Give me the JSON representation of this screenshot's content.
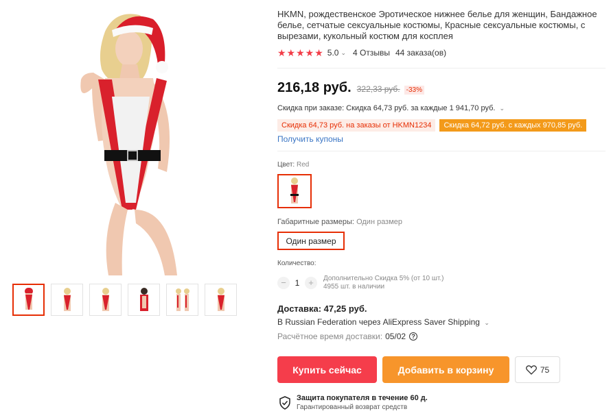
{
  "product": {
    "title": "HKMN, рождественское Эротическое нижнее белье для женщин, Бандажное белье, сетчатые сексуальные костюмы, Красные сексуальные костюмы, с вырезами, кукольный костюм для косплея",
    "rating": {
      "stars": "★★★★★",
      "value": "5.0",
      "reviews": "4 Отзывы",
      "orders": "44 заказа(ов)"
    },
    "price": {
      "current": "216,18 руб.",
      "old": "322,33 руб.",
      "discount": "-33%"
    },
    "coupon_line": "Скидка при заказе: Скидка 64,73 руб. за каждые 1 941,70 руб.",
    "badges": [
      "Скидка 64,73 руб. на заказы от HKMN1234",
      "Скидка 64,72 руб. с каждых 970,85 руб."
    ],
    "get_coupons": "Получить купоны",
    "color": {
      "label": "Цвет: ",
      "value": "Red"
    },
    "size": {
      "label": "Габаритные размеры: ",
      "value": "Один размер",
      "option": "Один размер"
    },
    "quantity": {
      "label": "Количество:",
      "value": "1",
      "minus": "−",
      "plus": "+",
      "extra_discount": "Дополнительно Скидка 5% (от 10 шт.)",
      "stock": "4955 шт. в наличии"
    },
    "delivery": {
      "cost": "Доставка: 47,25 руб.",
      "via": "В Russian Federation через AliExpress Saver Shipping",
      "est_label": "Расчётное время доставки:",
      "est_date": "05/02",
      "help": "?"
    },
    "buttons": {
      "buy": "Купить сейчас",
      "cart": "Добавить в корзину",
      "wishlist_count": "75"
    },
    "protection": {
      "title": "Защита покупателя в течение 60 д.",
      "subtitle": "Гарантированный возврат средств"
    }
  },
  "colors": {
    "accent": "#e62e04",
    "buy": "#f53d4b",
    "cart": "#f7952b",
    "link": "#3a75c4",
    "star": "#f23d48"
  },
  "icons": [
    "chevron-down-icon",
    "help-icon",
    "heart-icon",
    "shield-check-icon"
  ]
}
